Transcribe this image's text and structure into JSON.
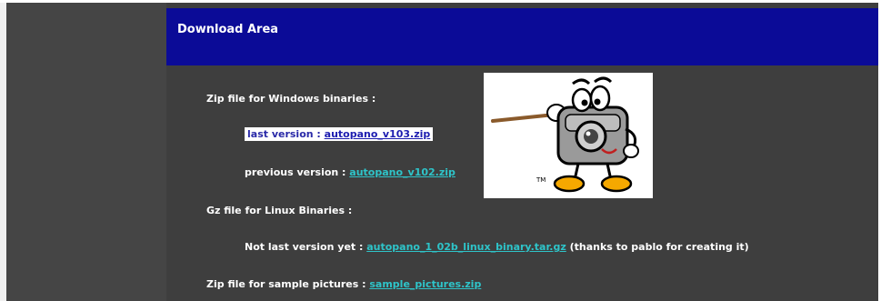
{
  "header": {
    "title": "Download Area"
  },
  "windows": {
    "heading": "Zip file for Windows binaries :",
    "last_version_label": "last version : ",
    "last_version_link": "autopano_v103.zip",
    "previous_version_label": "previous version : ",
    "previous_version_link": "autopano_v102.zip"
  },
  "linux": {
    "heading": "Gz file for Linux Binaries :",
    "label": "Not last version yet : ",
    "link": "autopano_1_02b_linux_binary.tar.gz",
    "note": " (thanks to pablo for creating it)"
  },
  "samples": {
    "label": "Zip file for sample pictures : ",
    "link": "sample_pictures.zip"
  },
  "colors": {
    "header_bg": "#0b0b97",
    "main_bg": "#3e3e3e",
    "link": "#2ec4c9"
  }
}
